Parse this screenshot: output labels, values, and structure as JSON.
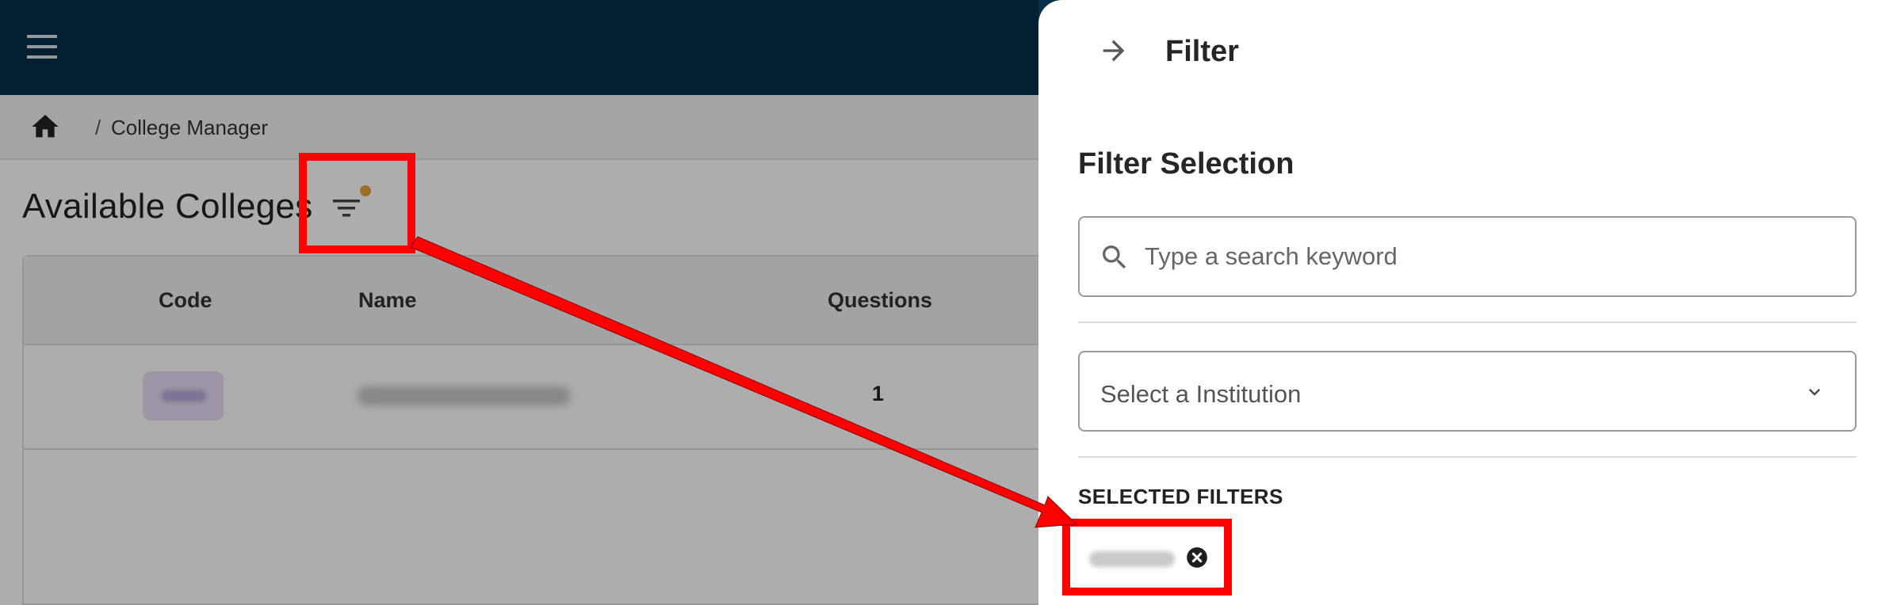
{
  "breadcrumb": {
    "separator": "/",
    "current": "College Manager"
  },
  "page": {
    "title": "Available Colleges"
  },
  "table": {
    "headers": {
      "code": "Code",
      "name": "Name",
      "questions": "Questions"
    },
    "rows": [
      {
        "questions": "1"
      }
    ]
  },
  "drawer": {
    "title": "Filter",
    "section_title": "Filter Selection",
    "search": {
      "placeholder": "Type a search keyword",
      "value": ""
    },
    "institution_select": {
      "placeholder": "Select a Institution"
    },
    "selected_filters_label": "SELECTED FILTERS"
  },
  "colors": {
    "topbar": "#062f4a",
    "filter_indicator": "#e8a33c",
    "annotation": "#ff0000"
  },
  "icons": [
    "menu-icon",
    "home-icon",
    "filter-icon",
    "arrow-right-icon",
    "search-icon",
    "chevron-down-icon",
    "close-circle-icon"
  ]
}
